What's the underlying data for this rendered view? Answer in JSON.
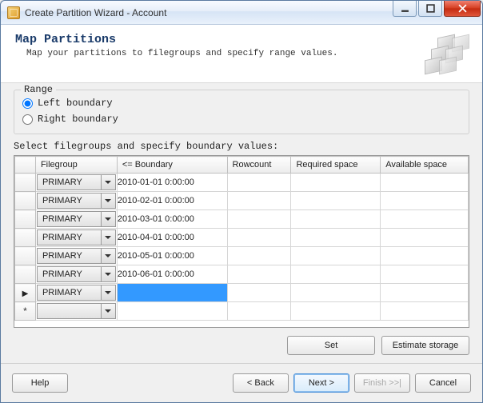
{
  "window": {
    "title": "Create Partition Wizard - Account"
  },
  "header": {
    "title": "Map Partitions",
    "subtitle": "Map your partitions to filegroups and specify range values."
  },
  "range": {
    "legend": "Range",
    "left_label": "Left boundary",
    "right_label": "Right boundary",
    "selected": "left"
  },
  "grid": {
    "label": "Select filegroups and specify boundary values:",
    "columns": {
      "filegroup": "Filegroup",
      "boundary": "<= Boundary",
      "rowcount": "Rowcount",
      "required_space": "Required space",
      "available_space": "Available space"
    },
    "rows": [
      {
        "marker": "",
        "filegroup": "PRIMARY",
        "boundary": "2010-01-01 0:00:00",
        "rowcount": "",
        "required": "",
        "available": "",
        "selected": false
      },
      {
        "marker": "",
        "filegroup": "PRIMARY",
        "boundary": "2010-02-01 0:00:00",
        "rowcount": "",
        "required": "",
        "available": "",
        "selected": false
      },
      {
        "marker": "",
        "filegroup": "PRIMARY",
        "boundary": "2010-03-01 0:00:00",
        "rowcount": "",
        "required": "",
        "available": "",
        "selected": false
      },
      {
        "marker": "",
        "filegroup": "PRIMARY",
        "boundary": "2010-04-01 0:00:00",
        "rowcount": "",
        "required": "",
        "available": "",
        "selected": false
      },
      {
        "marker": "",
        "filegroup": "PRIMARY",
        "boundary": "2010-05-01 0:00:00",
        "rowcount": "",
        "required": "",
        "available": "",
        "selected": false
      },
      {
        "marker": "",
        "filegroup": "PRIMARY",
        "boundary": "2010-06-01 0:00:00",
        "rowcount": "",
        "required": "",
        "available": "",
        "selected": false
      },
      {
        "marker": "▶",
        "filegroup": "PRIMARY",
        "boundary": "",
        "rowcount": "",
        "required": "",
        "available": "",
        "selected": true
      },
      {
        "marker": "*",
        "filegroup": "",
        "boundary": "",
        "rowcount": "",
        "required": "",
        "available": "",
        "selected": false
      }
    ]
  },
  "buttons": {
    "set": "Set",
    "estimate": "Estimate storage",
    "help": "Help",
    "back": "< Back",
    "next": "Next >",
    "finish": "Finish >>|",
    "cancel": "Cancel"
  }
}
